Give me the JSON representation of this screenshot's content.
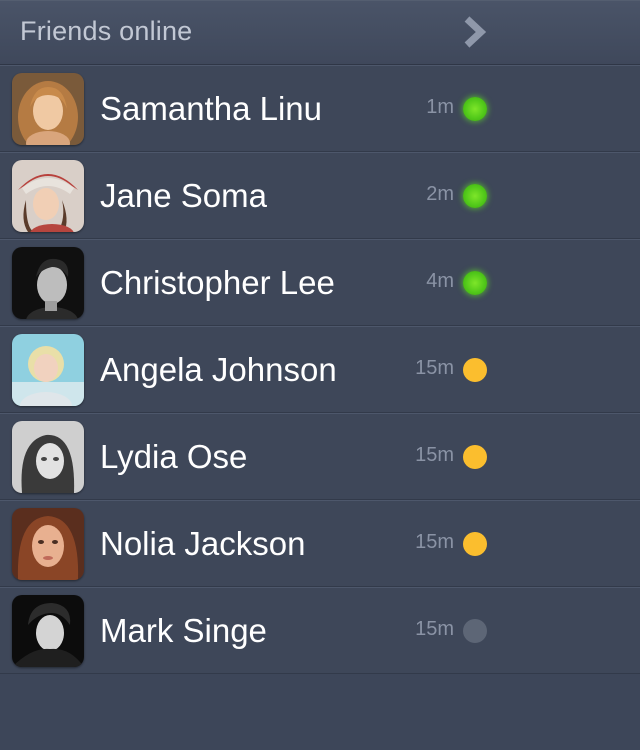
{
  "header": {
    "title": "Friends online",
    "chevron_icon": "chevron-right-icon"
  },
  "colors": {
    "background": "#3d4659",
    "online": "#5ad21e",
    "away": "#fbbe2e",
    "offline": "#5d6676"
  },
  "friends": [
    {
      "name": "Samantha Linu",
      "time": "1m",
      "status": "online",
      "avatar": "avatar-photo"
    },
    {
      "name": "Jane Soma",
      "time": "2m",
      "status": "online",
      "avatar": "avatar-photo"
    },
    {
      "name": "Christopher Lee",
      "time": "4m",
      "status": "online",
      "avatar": "avatar-photo"
    },
    {
      "name": "Angela Johnson",
      "time": "15m",
      "status": "away",
      "avatar": "avatar-photo"
    },
    {
      "name": "Lydia Ose",
      "time": "15m",
      "status": "away",
      "avatar": "avatar-photo"
    },
    {
      "name": "Nolia Jackson",
      "time": "15m",
      "status": "away",
      "avatar": "avatar-photo"
    },
    {
      "name": "Mark Singe",
      "time": "15m",
      "status": "offline",
      "avatar": "avatar-photo"
    }
  ]
}
